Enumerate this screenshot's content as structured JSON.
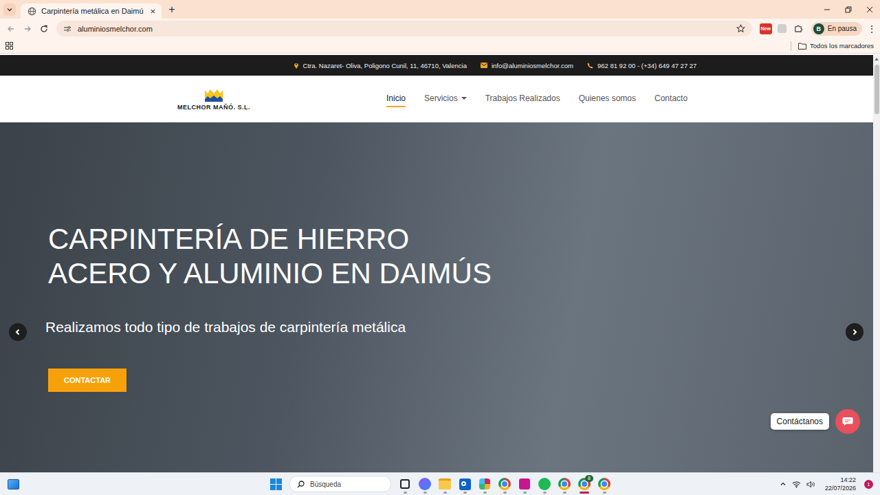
{
  "browser": {
    "tabs": [
      {
        "title": "Carpintería metálica en Daimú",
        "close": "×",
        "selected": true
      }
    ],
    "new_tab": "+",
    "address": "aluminiosmelchor.com",
    "extension_badge": "New",
    "profile": {
      "initial": "B",
      "status": "En pausa"
    },
    "menu": "⋮",
    "bookmarks_bar": {
      "all_bookmarks": "Todos los marcadores"
    }
  },
  "site": {
    "topbar": {
      "address": "Ctra. Nazaret- Oliva, Poligono Cunil, 11, 46710, Valencia",
      "email": "info@aluminiosmelchor.com",
      "phone": "962 81 92 00 - (+34) 649 47 27 27"
    },
    "logo": {
      "text": "MELCHOR MAÑÓ. S.L."
    },
    "nav": [
      {
        "label": "Inicio",
        "selected": true,
        "dropdown": false
      },
      {
        "label": "Servicios",
        "selected": false,
        "dropdown": true
      },
      {
        "label": "Trabajos Realizados",
        "selected": false,
        "dropdown": false
      },
      {
        "label": "Quienes somos",
        "selected": false,
        "dropdown": false
      },
      {
        "label": "Contacto",
        "selected": false,
        "dropdown": false
      }
    ],
    "hero": {
      "title_lines": [
        "CARPINTERÍA DE HIERRO",
        "ACERO Y ALUMINIO EN DAIMÚS"
      ],
      "subtitle": "Realizamos todo tipo de trabajos de carpintería metálica",
      "button": "CONTACTAR"
    },
    "chat": {
      "label": "Contáctanos"
    }
  },
  "taskbar": {
    "search_placeholder": "Búsqueda",
    "apps": [
      {
        "kind": "taskview",
        "selected": false
      },
      {
        "kind": "copilot",
        "selected": false
      },
      {
        "kind": "explorer",
        "selected": false
      },
      {
        "kind": "outlook",
        "selected": false
      },
      {
        "kind": "slack",
        "selected": false
      },
      {
        "kind": "chrome",
        "selected": false
      },
      {
        "kind": "paint",
        "selected": false
      },
      {
        "kind": "spotify",
        "selected": false
      },
      {
        "kind": "chrome",
        "selected": false
      },
      {
        "kind": "chrome",
        "selected": true,
        "badge": "8"
      },
      {
        "kind": "chrome",
        "selected": false
      }
    ],
    "time": "14:22",
    "date": "22/07/2026",
    "notifications": "1"
  }
}
